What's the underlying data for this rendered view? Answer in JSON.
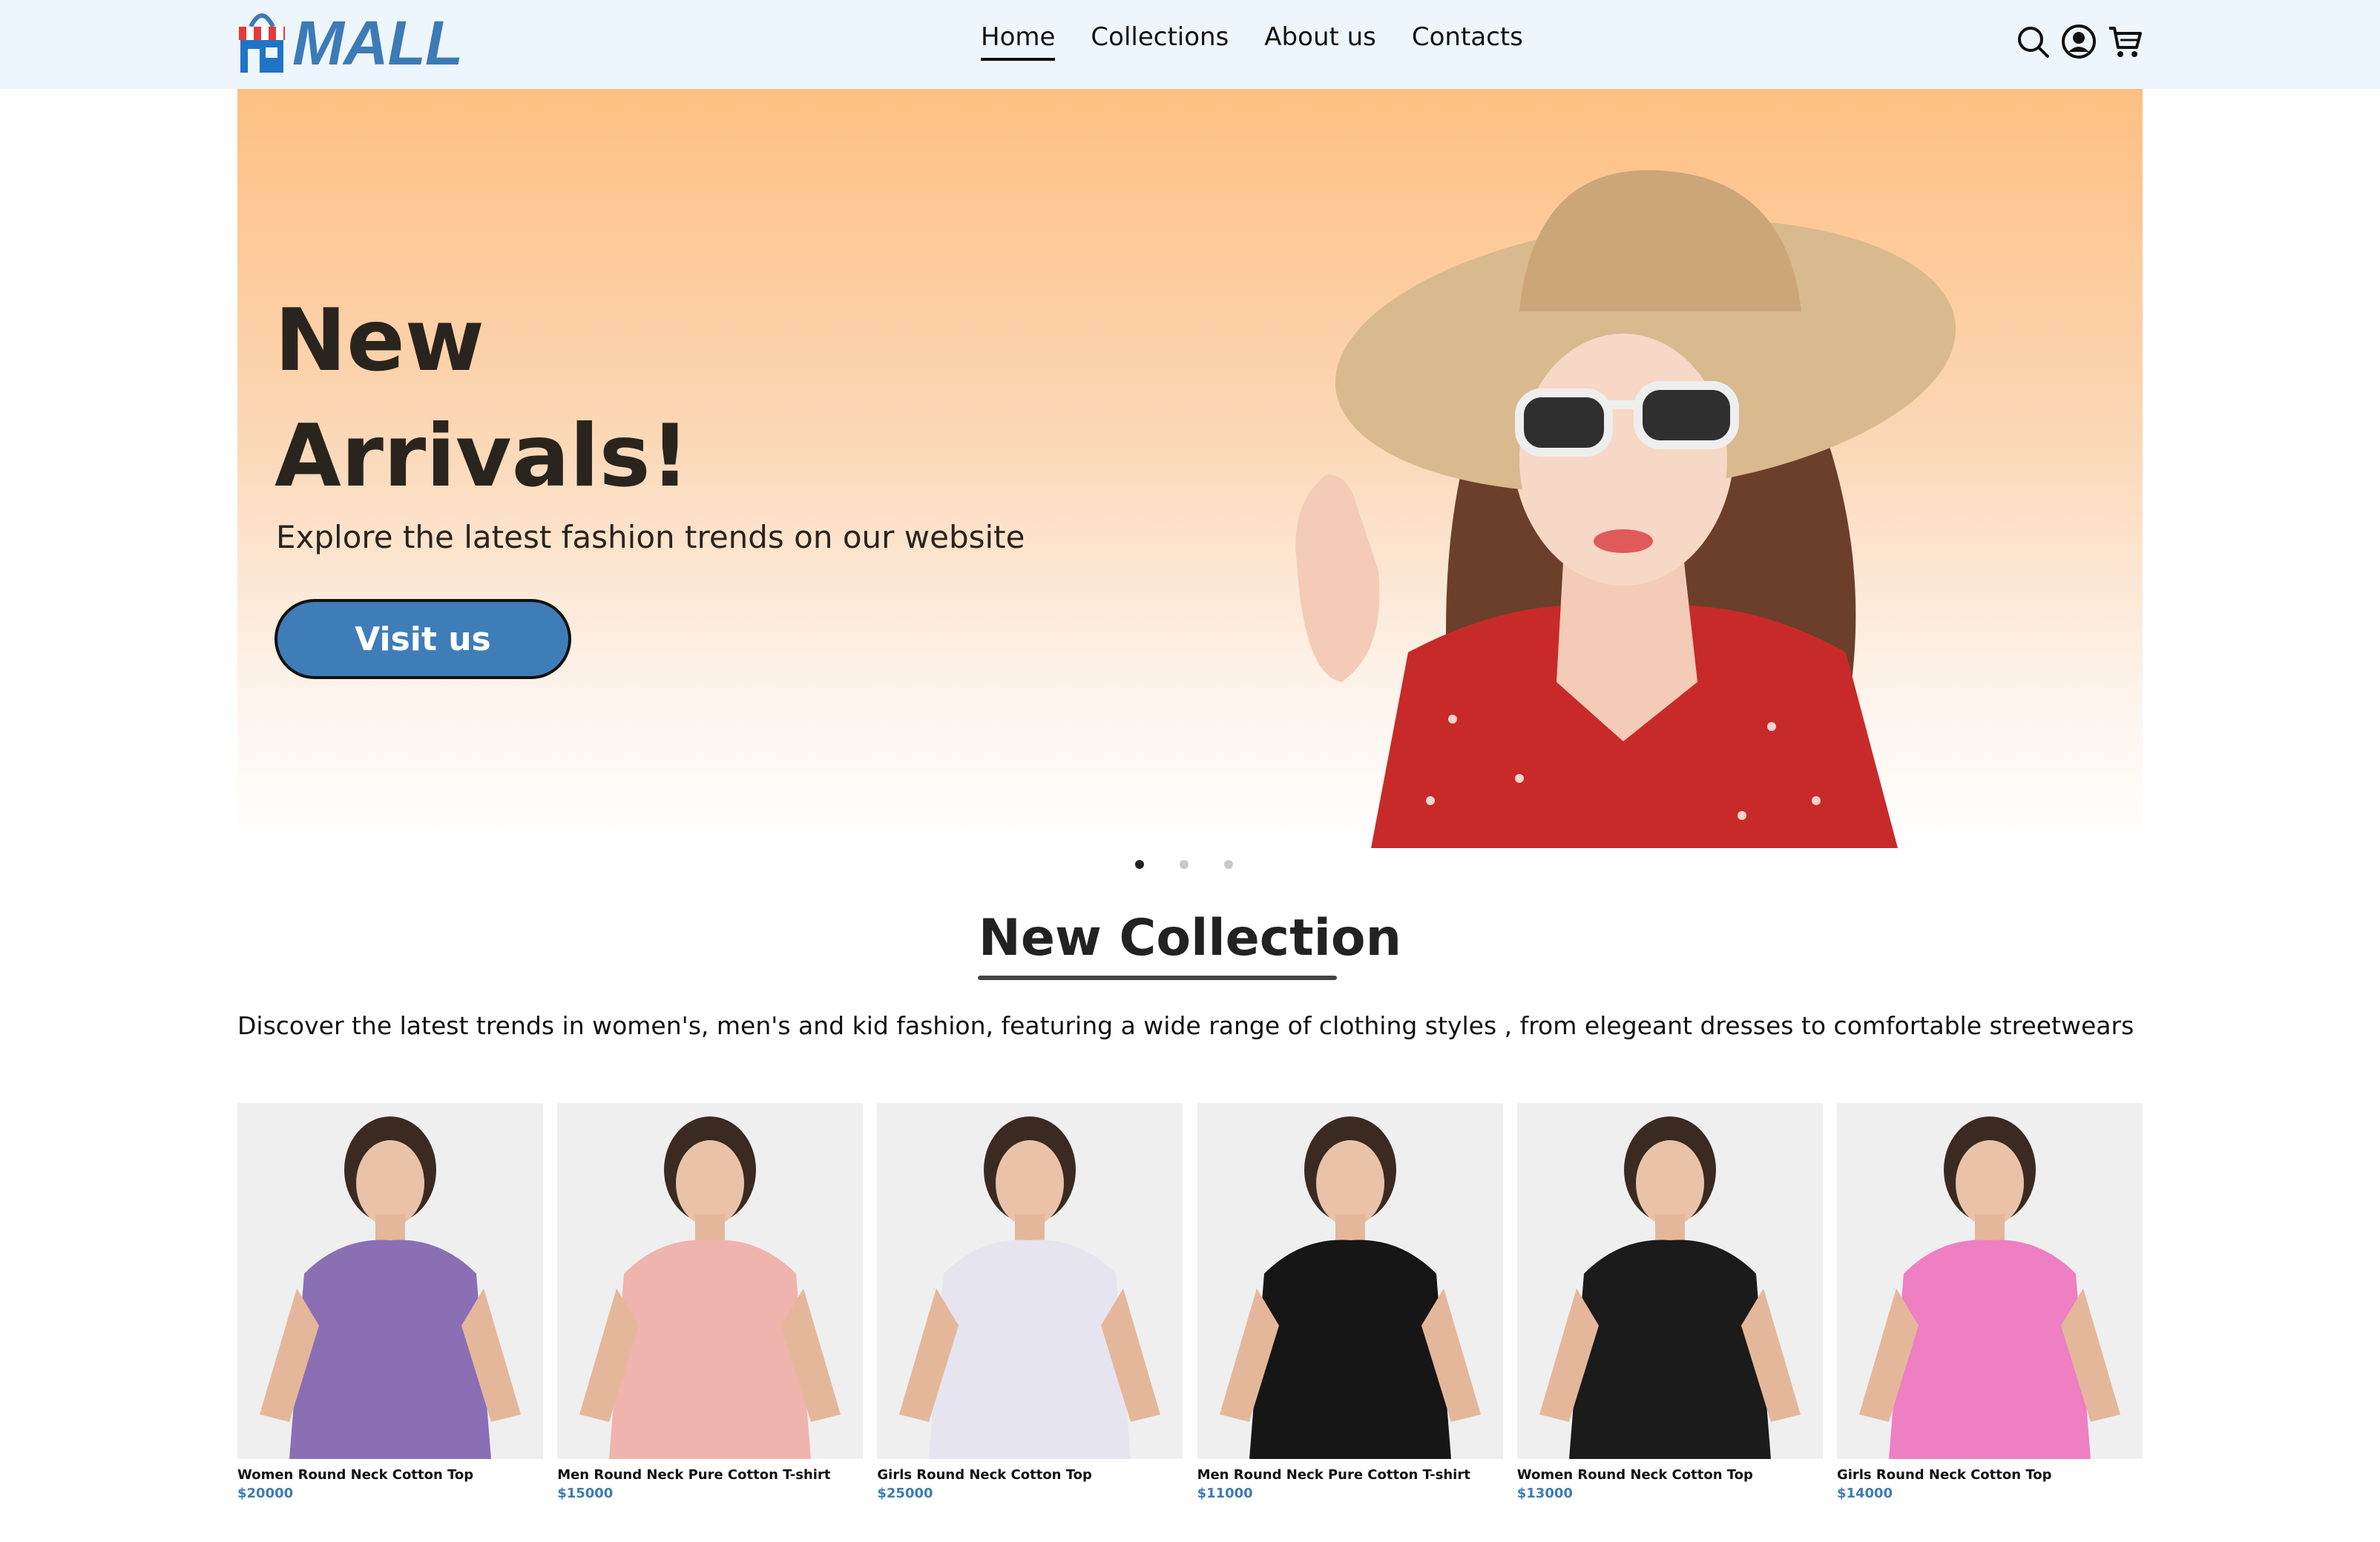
{
  "header": {
    "logo_text": "MALL",
    "nav": [
      {
        "label": "Home",
        "active": true
      },
      {
        "label": "Collections",
        "active": false
      },
      {
        "label": "About us",
        "active": false
      },
      {
        "label": "Contacts",
        "active": false
      }
    ],
    "icons": [
      "search-icon",
      "user-icon",
      "cart-icon"
    ]
  },
  "hero": {
    "title_line1": "New",
    "title_line2": "Arrivals!",
    "subtitle": "Explore the latest fashion trends on our website",
    "button_label": "Visit us",
    "slides": 3,
    "active_slide": 1
  },
  "collection": {
    "title": "New Collection",
    "description": "Discover the latest trends in women's, men's and kid fashion, featuring a wide range of clothing styles , from elegeant dresses to comfortable streetwears"
  },
  "products": [
    {
      "name": "Women Round Neck Cotton Top",
      "price": "$20000",
      "shirt_color": "#8a6fb5"
    },
    {
      "name": "Men Round Neck Pure Cotton T-shirt",
      "price": "$15000",
      "shirt_color": "#efb4ad"
    },
    {
      "name": "Girls Round Neck Cotton Top",
      "price": "$25000",
      "shirt_color": "#e6e4ee"
    },
    {
      "name": "Men Round Neck Pure Cotton T-shirt",
      "price": "$11000",
      "shirt_color": "#161616"
    },
    {
      "name": "Women Round Neck Cotton Top",
      "price": "$13000",
      "shirt_color": "#1b1b1b"
    },
    {
      "name": "Girls Round Neck Cotton Top",
      "price": "$14000",
      "shirt_color": "#ee7fc3"
    }
  ],
  "colors": {
    "brand": "#3d7bb6",
    "header_bg": "#eef6fd",
    "hero_top": "#ffbf82"
  }
}
